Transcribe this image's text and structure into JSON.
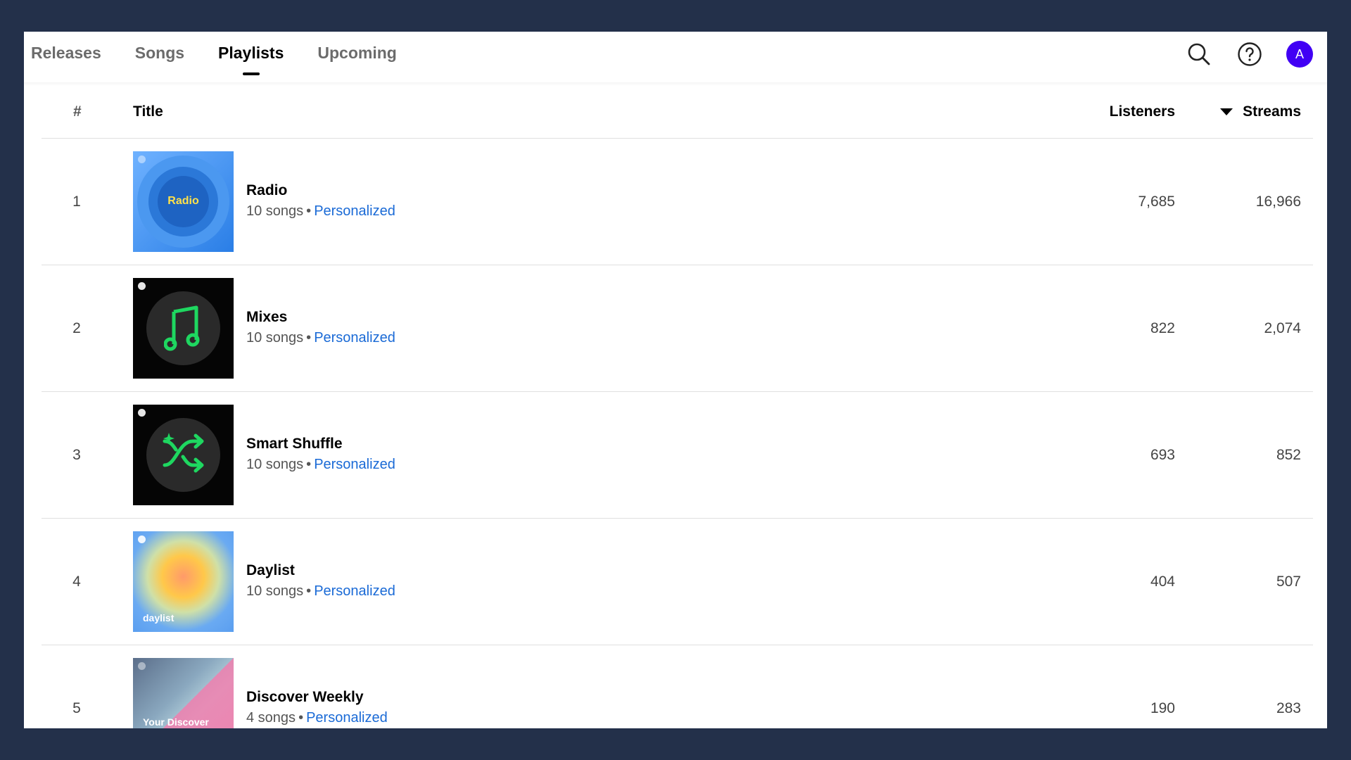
{
  "tabs": [
    {
      "label": "Releases",
      "active": false
    },
    {
      "label": "Songs",
      "active": false
    },
    {
      "label": "Playlists",
      "active": true
    },
    {
      "label": "Upcoming",
      "active": false
    }
  ],
  "header": {
    "icons": [
      "search-icon",
      "help-icon"
    ],
    "avatar_initial": "A",
    "avatar_color": "#4100f4"
  },
  "table": {
    "columns": {
      "num": "#",
      "title": "Title",
      "listeners": "Listeners",
      "streams": "Streams"
    },
    "sort": {
      "column": "streams",
      "direction": "desc"
    },
    "rows": [
      {
        "rank": "1",
        "title": "Radio",
        "songs": "10 songs",
        "sep": "•",
        "tag": "Personalized",
        "listeners": "7,685",
        "streams": "16,966",
        "cover_label": "Radio"
      },
      {
        "rank": "2",
        "title": "Mixes",
        "songs": "10 songs",
        "sep": "•",
        "tag": "Personalized",
        "listeners": "822",
        "streams": "2,074",
        "cover_label": ""
      },
      {
        "rank": "3",
        "title": "Smart Shuffle",
        "songs": "10 songs",
        "sep": "•",
        "tag": "Personalized",
        "listeners": "693",
        "streams": "852",
        "cover_label": ""
      },
      {
        "rank": "4",
        "title": "Daylist",
        "songs": "10 songs",
        "sep": "•",
        "tag": "Personalized",
        "listeners": "404",
        "streams": "507",
        "cover_label": "daylist"
      },
      {
        "rank": "5",
        "title": "Discover Weekly",
        "songs": "4 songs",
        "sep": "•",
        "tag": "Personalized",
        "listeners": "190",
        "streams": "283",
        "cover_label": "Your Discover"
      }
    ]
  },
  "colors": {
    "link": "#1a6ad6",
    "accent_green": "#1ed760",
    "background": "#23304a"
  }
}
